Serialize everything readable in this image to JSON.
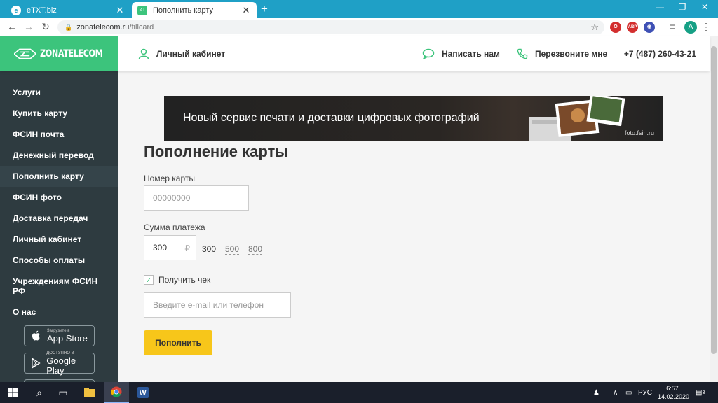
{
  "browser": {
    "tabs": [
      {
        "title": "eTXT.biz",
        "favicon": "etxt-favicon"
      },
      {
        "title": "Пополнить карту",
        "favicon": "zonatelecom-favicon"
      }
    ],
    "new_tab_label": "+",
    "url_domain": "zonatelecom.ru",
    "url_path": "/fillcard",
    "extensions": [
      {
        "name": "opera-extension",
        "label": "O",
        "color": "#d32f2f"
      },
      {
        "name": "adblock-extension",
        "label": "ABP",
        "color": "#d32f2f"
      },
      {
        "name": "globe-extension",
        "label": "◉",
        "color": "#3f51b5"
      }
    ],
    "profile_initial": "A"
  },
  "header": {
    "logo_text": "ZONATELECOM",
    "account_label": "Личный кабинет",
    "write_label": "Написать нам",
    "callback_label": "Перезвоните мне",
    "phone": "+7 (487) 260-43-21",
    "accent_color": "#3cc47c"
  },
  "sidebar": {
    "items": [
      {
        "label": "Услуги"
      },
      {
        "label": "Купить карту"
      },
      {
        "label": "ФСИН почта"
      },
      {
        "label": "Денежный перевод"
      },
      {
        "label": "Пополнить карту"
      },
      {
        "label": "ФСИН фото"
      },
      {
        "label": "Доставка передач"
      },
      {
        "label": "Личный кабинет"
      },
      {
        "label": "Способы оплаты"
      },
      {
        "label": "Учреждениям ФСИН РФ"
      },
      {
        "label": "О нас"
      }
    ],
    "active_index": 4,
    "appstore": {
      "small": "Загрузите в",
      "big": "App Store"
    },
    "googleplay": {
      "small": "ДОСТУПНО В",
      "big": "Google Play"
    }
  },
  "banner": {
    "text": "Новый сервис печати и доставки цифровых фотографий",
    "url": "foto.fsin.ru"
  },
  "form": {
    "title": "Пополнение карты",
    "card_label": "Номер карты",
    "card_placeholder": "00000000",
    "amount_label": "Сумма платежа",
    "amount_value": "300",
    "currency": "₽",
    "presets": [
      "300",
      "500",
      "800"
    ],
    "receipt_label": "Получить чек",
    "receipt_checked": true,
    "contact_placeholder": "Введите e-mail или телефон",
    "submit_label": "Пополнить"
  },
  "taskbar": {
    "lang": "РУС",
    "time": "6:57",
    "date": "14.02.2020",
    "notification_count": "3"
  }
}
